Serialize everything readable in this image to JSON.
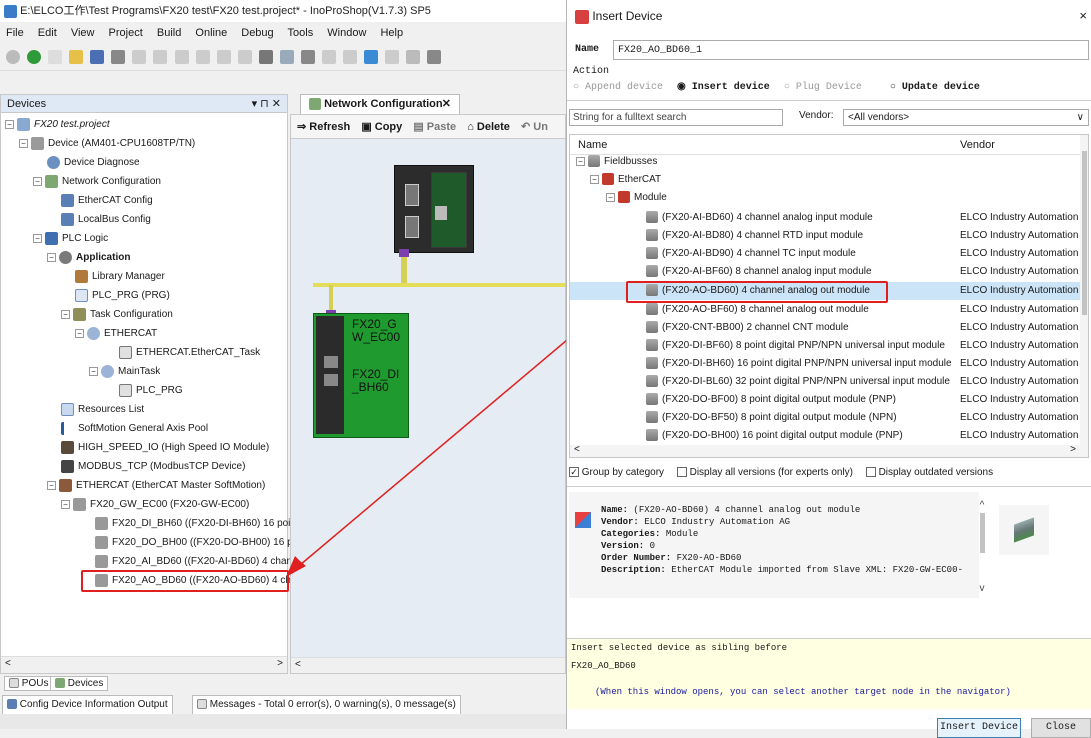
{
  "main_window": {
    "title": "E:\\ELCO工作\\Test Programs\\FX20 test\\FX20 test.project* - InoProShop(V1.7.3) SP5",
    "menu": [
      "File",
      "Edit",
      "View",
      "Project",
      "Build",
      "Online",
      "Debug",
      "Tools",
      "Window",
      "Help"
    ]
  },
  "devices_panel": {
    "title": "Devices",
    "pin_label": "▾ ⊓ ✕",
    "items": [
      {
        "label": "FX20 test.project",
        "italic": true
      },
      {
        "label": "Device (AM401-CPU1608TP/TN)"
      },
      {
        "label": "Device Diagnose"
      },
      {
        "label": "Network Configuration"
      },
      {
        "label": "EtherCAT Config"
      },
      {
        "label": "LocalBus Config"
      },
      {
        "label": "PLC Logic"
      },
      {
        "label": "Application",
        "bold": true
      },
      {
        "label": "Library Manager"
      },
      {
        "label": "PLC_PRG (PRG)"
      },
      {
        "label": "Task Configuration"
      },
      {
        "label": "ETHERCAT"
      },
      {
        "label": "ETHERCAT.EtherCAT_Task"
      },
      {
        "label": "MainTask"
      },
      {
        "label": "PLC_PRG"
      },
      {
        "label": "Resources List"
      },
      {
        "label": "SoftMotion General Axis Pool"
      },
      {
        "label": "HIGH_SPEED_IO (High Speed IO Module)"
      },
      {
        "label": "MODBUS_TCP (ModbusTCP Device)"
      },
      {
        "label": "ETHERCAT (EtherCAT Master SoftMotion)"
      },
      {
        "label": "FX20_GW_EC00 (FX20-GW-EC00)"
      },
      {
        "label": "FX20_DI_BH60 ((FX20-DI-BH60) 16 point"
      },
      {
        "label": "FX20_DO_BH00 ((FX20-DO-BH00) 16 poi"
      },
      {
        "label": "FX20_AI_BD60 ((FX20-AI-BD60) 4 chann"
      },
      {
        "label": "FX20_AO_BD60 ((FX20-AO-BD60) 4 char"
      }
    ],
    "bottom_tabs": [
      "POUs",
      "Devices"
    ]
  },
  "network_config": {
    "tab_title": "Network Configuration",
    "toolbar": {
      "refresh": "Refresh",
      "copy": "Copy",
      "paste": "Paste",
      "delete": "Delete",
      "undo": "Un"
    },
    "module_label_1": "FX20_G\nW_EC00",
    "module_label_2": "FX20_DI\n_BH60"
  },
  "status_bar": {
    "config_output": "Config Device Information Output",
    "messages": "Messages - Total 0 error(s), 0 warning(s), 0 message(s)"
  },
  "dialog": {
    "title": "Insert Device",
    "close": "×",
    "name_label": "Name",
    "name_value": "FX20_AO_BD60_1",
    "action_label": "Action",
    "actions": [
      "Append device",
      "Insert device",
      "Plug Device",
      "Update device"
    ],
    "search_placeholder": "String for a fulltext search",
    "vendor_label": "Vendor:",
    "vendor_value": "<All vendors>",
    "col_name": "Name",
    "col_vendor": "Vendor",
    "tree_root": "Fieldbusses",
    "tree_ethercat": "EtherCAT",
    "tree_module": "Module",
    "devices": [
      {
        "name": "(FX20-AI-BD60) 4 channel analog input module",
        "vendor": "ELCO Industry Automation A"
      },
      {
        "name": "(FX20-AI-BD80) 4 channel RTD input module",
        "vendor": "ELCO Industry Automation A"
      },
      {
        "name": "(FX20-AI-BD90) 4 channel TC input module",
        "vendor": "ELCO Industry Automation A"
      },
      {
        "name": "(FX20-AI-BF60) 8 channel analog input module",
        "vendor": "ELCO Industry Automation A"
      },
      {
        "name": "(FX20-AO-BD60) 4 channel analog out module",
        "vendor": "ELCO Industry Automation A",
        "selected": true
      },
      {
        "name": "(FX20-AO-BF60) 8 channel analog out module",
        "vendor": "ELCO Industry Automation A"
      },
      {
        "name": "(FX20-CNT-BB00) 2 channel CNT module",
        "vendor": "ELCO Industry Automation A"
      },
      {
        "name": "(FX20-DI-BF60) 8 point digital PNP/NPN universal input module",
        "vendor": "ELCO Industry Automation A"
      },
      {
        "name": "(FX20-DI-BH60) 16 point digital PNP/NPN universal input module",
        "vendor": "ELCO Industry Automation A"
      },
      {
        "name": "(FX20-DI-BL60) 32 point digital PNP/NPN universal input module",
        "vendor": "ELCO Industry Automation A"
      },
      {
        "name": "(FX20-DO-BF00) 8 point digital output module (PNP)",
        "vendor": "ELCO Industry Automation A"
      },
      {
        "name": "(FX20-DO-BF50) 8 point digital output module (NPN)",
        "vendor": "ELCO Industry Automation A"
      },
      {
        "name": "(FX20-DO-BH00) 16 point digital output module (PNP)",
        "vendor": "ELCO Industry Automation A"
      }
    ],
    "checkboxes": [
      "Group by category",
      "Display all versions (for experts only)",
      "Display outdated versions"
    ],
    "info": {
      "name_k": "Name:",
      "name_v": "(FX20-AO-BD60) 4 channel analog out module",
      "vendor_k": "Vendor:",
      "vendor_v": "ELCO Industry Automation AG",
      "cat_k": "Categories:",
      "cat_v": "Module",
      "ver_k": "Version:",
      "ver_v": "0",
      "order_k": "Order Number:",
      "order_v": "FX20-AO-BD60",
      "desc_k": "Description:",
      "desc_v": "EtherCAT Module imported from Slave XML: FX20-GW-EC00-"
    },
    "hint_line1": "Insert selected device as sibling before",
    "hint_line2": "FX20_AO_BD60",
    "hint_line3": "(When this window opens, you can select another target node in the navigator)",
    "insert_button": "Insert Device",
    "close_button": "Close"
  }
}
